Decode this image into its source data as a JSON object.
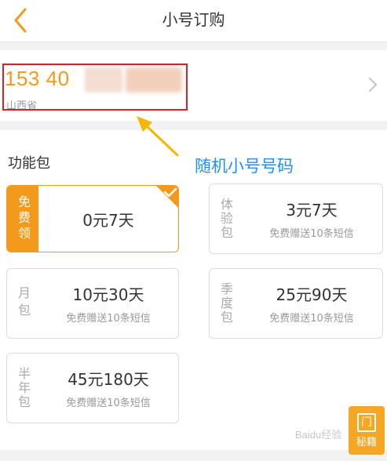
{
  "header": {
    "title": "小号订购"
  },
  "number_card": {
    "phone_prefix": "153 40",
    "province": "山西省"
  },
  "annotation": {
    "text": "随机小号号码",
    "color": "#1e90ff",
    "highlight_color": "#e02020"
  },
  "packages_section": {
    "title": "功能包",
    "items": [
      {
        "side_label": "免费领",
        "price": "0元7天",
        "note": "",
        "selected": true
      },
      {
        "side_label": "体验包",
        "price": "3元7天",
        "note": "免费赠送10条短信",
        "selected": false
      },
      {
        "side_label": "月包",
        "price": "10元30天",
        "note": "免费赠送10条短信",
        "selected": false
      },
      {
        "side_label": "季度包",
        "price": "25元90天",
        "note": "免费赠送10条短信",
        "selected": false
      },
      {
        "side_label": "半年包",
        "price": "45元180天",
        "note": "免费赠送10条短信",
        "selected": false
      }
    ]
  },
  "theme": {
    "accent": "#f39a1c"
  },
  "watermark": {
    "badge_text": "秘籍",
    "site_text": "Baidu经验"
  }
}
